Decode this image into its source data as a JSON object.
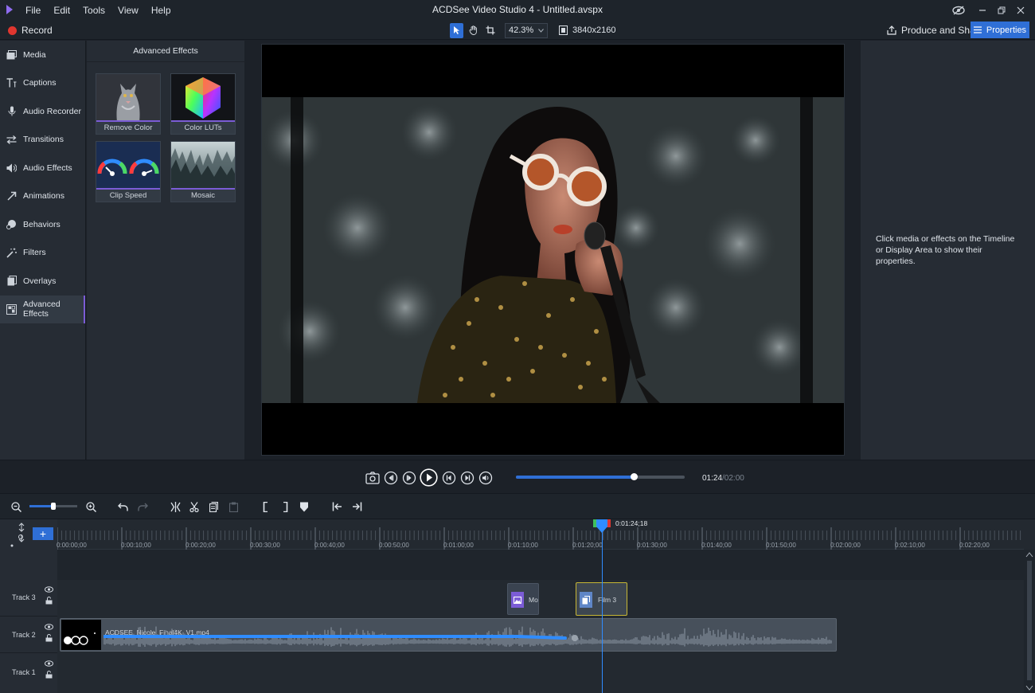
{
  "app": {
    "title": "ACDSee Video Studio 4 - Untitled.avspx",
    "menu": [
      "File",
      "Edit",
      "Tools",
      "View",
      "Help"
    ]
  },
  "toolbar": {
    "record_label": "Record",
    "zoom_value": "42.3%",
    "resolution": "3840x2160",
    "produce_label": "Produce and Share",
    "properties_label": "Properties"
  },
  "nav": {
    "items": [
      {
        "label": "Media",
        "icon": "media-icon"
      },
      {
        "label": "Captions",
        "icon": "captions-icon"
      },
      {
        "label": "Audio Recorder",
        "icon": "microphone-icon"
      },
      {
        "label": "Transitions",
        "icon": "transitions-icon"
      },
      {
        "label": "Audio Effects",
        "icon": "speaker-icon"
      },
      {
        "label": "Animations",
        "icon": "animation-arrow-icon"
      },
      {
        "label": "Behaviors",
        "icon": "behaviors-icon"
      },
      {
        "label": "Filters",
        "icon": "magic-wand-icon"
      },
      {
        "label": "Overlays",
        "icon": "overlays-icon"
      },
      {
        "label": "Advanced Effects",
        "icon": "advanced-effects-icon",
        "active": true
      }
    ]
  },
  "effects": {
    "title": "Advanced Effects",
    "items": [
      {
        "label": "Remove Color"
      },
      {
        "label": "Color LUTs"
      },
      {
        "label": "Clip Speed"
      },
      {
        "label": "Mosaic"
      }
    ]
  },
  "properties": {
    "hint": "Click media or effects on the Timeline or Display Area to show their properties."
  },
  "playback": {
    "current_time": "01:24",
    "total_time": "/02:00",
    "progress": 0.7
  },
  "timeline": {
    "zoom_level": 0.5,
    "playhead_label": "0:01:24;18",
    "ruler_labels": [
      "0:00:00;00",
      "0:00:10;00",
      "0:00:20;00",
      "0:00:30;00",
      "0:00:40;00",
      "0:00:50;00",
      "0:01:00;00",
      "0:01:10;00",
      "0:01:20;00",
      "0:01:30;00",
      "0:01:40;00",
      "0:01:50;00",
      "0:02:00;00",
      "0:02:10;00",
      "0:02:20;00"
    ],
    "tracks": [
      {
        "name": "Track 3"
      },
      {
        "name": "Track 2"
      },
      {
        "name": "Track 1"
      }
    ],
    "clips": {
      "mosaic": "Mos",
      "film": "Film 3",
      "video": "ACDSEE_Nicole_Final4K_V1.mp4"
    }
  }
}
